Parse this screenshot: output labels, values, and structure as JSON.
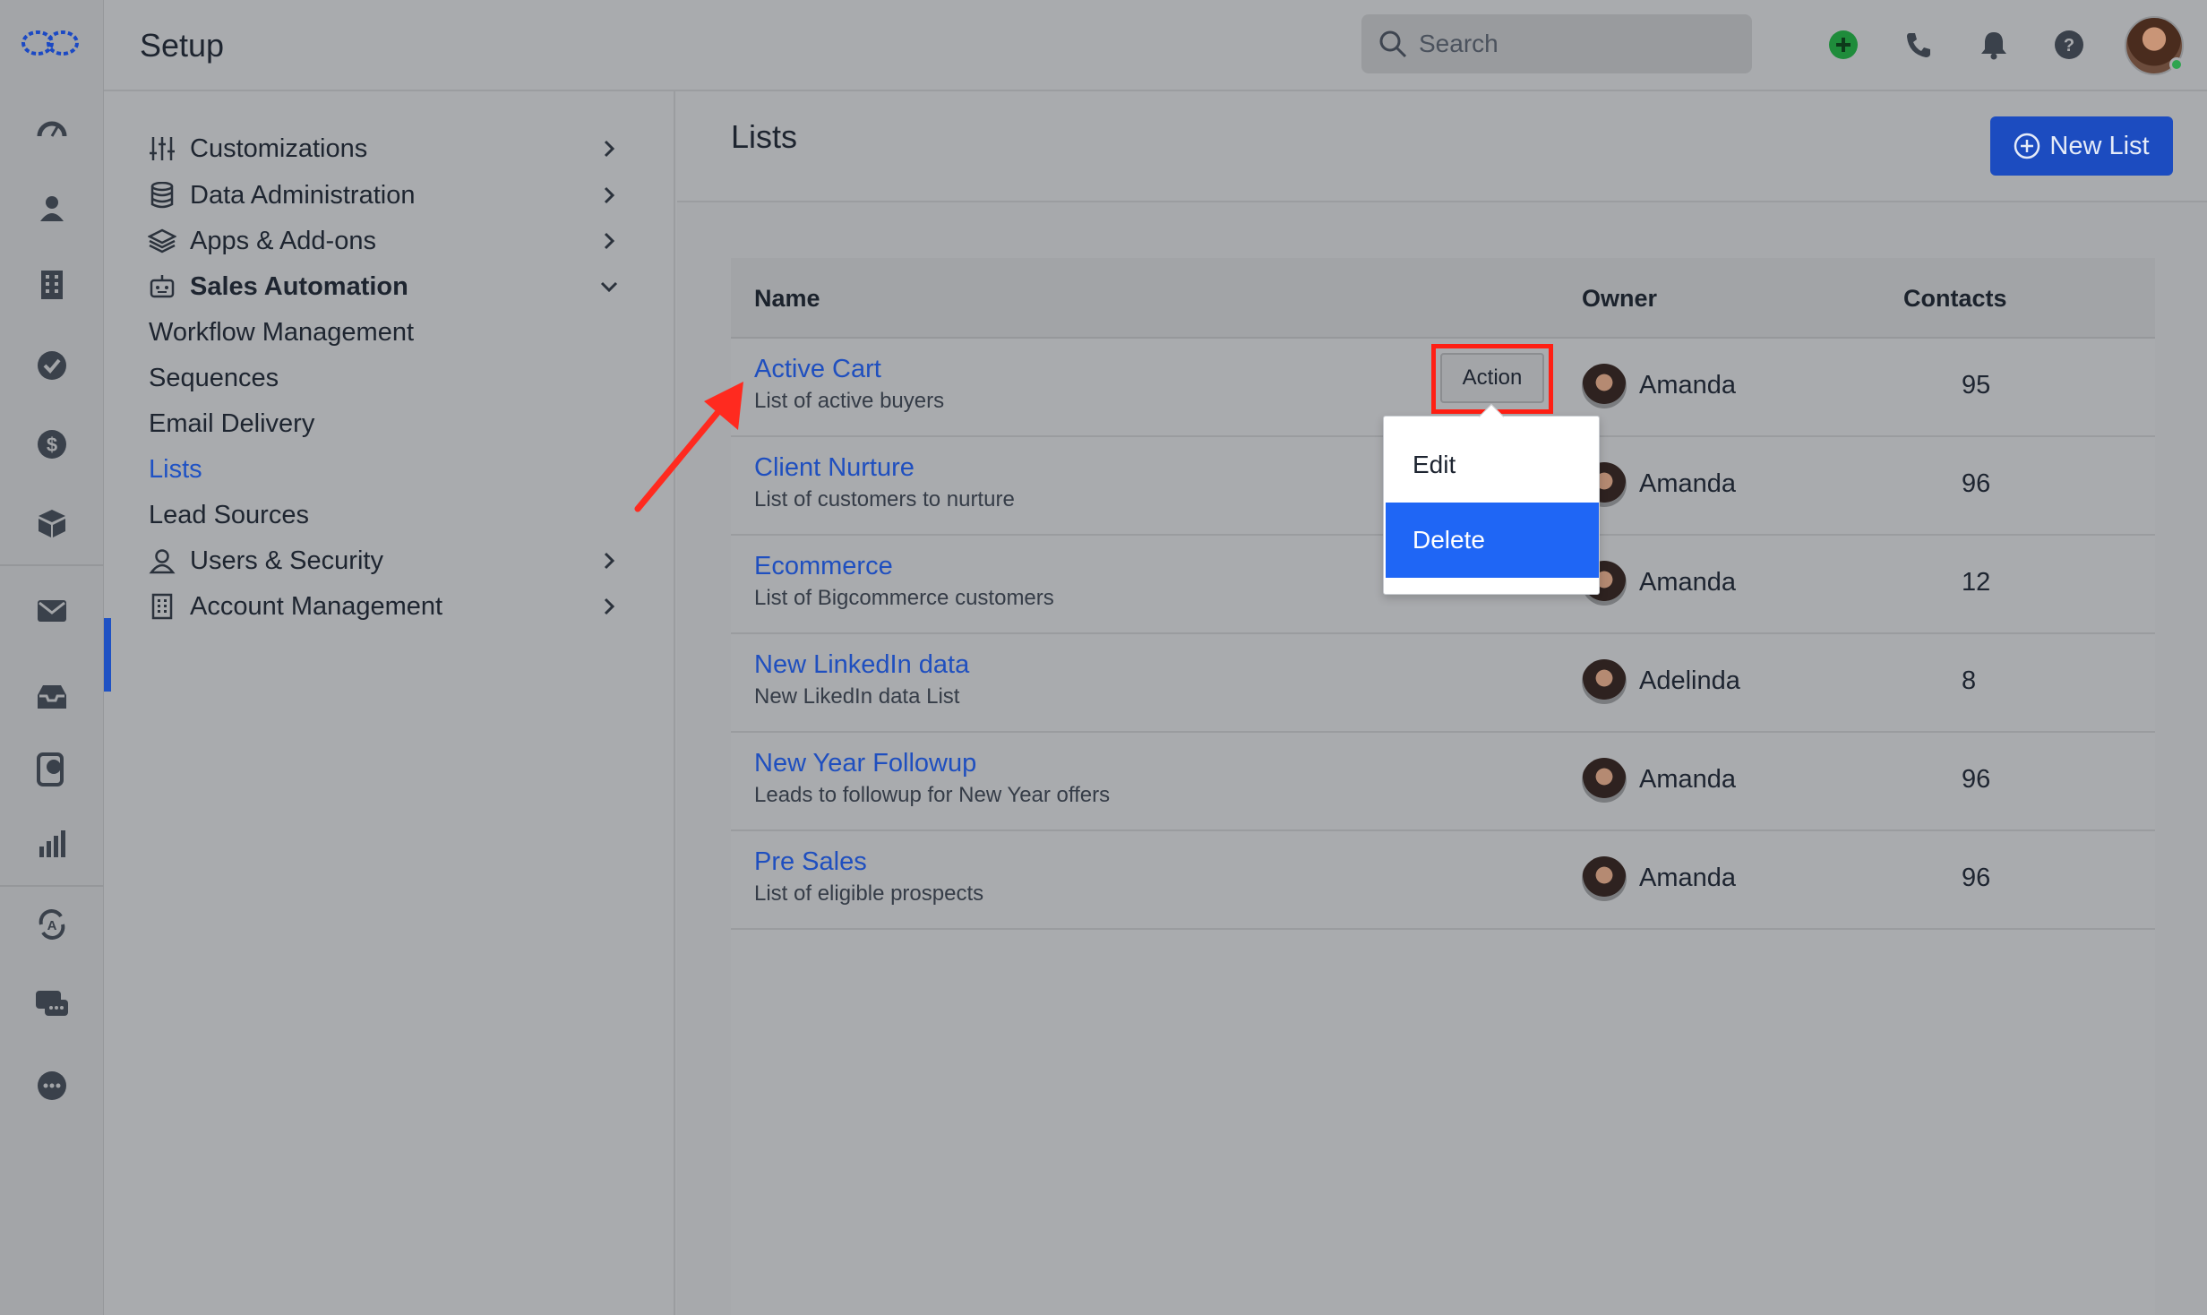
{
  "app": {
    "title": "Setup"
  },
  "search": {
    "placeholder": "Search"
  },
  "topbar": {
    "icons": [
      "add-circle-icon",
      "phone-icon",
      "bell-icon",
      "help-icon"
    ],
    "accent_add": "#2ea44f"
  },
  "rail": {
    "icons": [
      "logo-icon",
      "dashboard-icon",
      "contacts-icon",
      "accounts-icon",
      "tasks-icon",
      "deals-icon",
      "products-icon",
      "email-icon",
      "inbox-icon",
      "chat-support-icon",
      "reports-icon",
      "automation-icon",
      "messages-icon",
      "more-icon"
    ]
  },
  "nav": {
    "items": [
      {
        "label": "Customizations",
        "icon": "sliders-icon",
        "expandable": true
      },
      {
        "label": "Data Administration",
        "icon": "database-icon",
        "expandable": true
      },
      {
        "label": "Apps & Add-ons",
        "icon": "layers-icon",
        "expandable": true
      },
      {
        "label": "Sales Automation",
        "icon": "robot-icon",
        "expanded": true
      },
      {
        "label": "Workflow Management"
      },
      {
        "label": "Sequences"
      },
      {
        "label": "Email Delivery"
      },
      {
        "label": "Lists",
        "active": true
      },
      {
        "label": "Lead Sources"
      },
      {
        "label": "Users & Security",
        "icon": "user-icon",
        "expandable": true
      },
      {
        "label": "Account Management",
        "icon": "building-icon",
        "expandable": true
      }
    ]
  },
  "main": {
    "title": "Lists",
    "new_button": "New List",
    "columns": {
      "name": "Name",
      "owner": "Owner",
      "contacts": "Contacts"
    },
    "rows": [
      {
        "name": "Active Cart",
        "description": "List of active buyers",
        "owner": "Amanda",
        "contacts": "95"
      },
      {
        "name": "Client Nurture",
        "description": "List of customers to nurture",
        "owner": "Amanda",
        "contacts": "96"
      },
      {
        "name": "Ecommerce",
        "description": "List of Bigcommerce customers",
        "owner": "Amanda",
        "contacts": "12"
      },
      {
        "name": "New LinkedIn data",
        "description": "New LikedIn data List",
        "owner": "Adelinda",
        "contacts": "8"
      },
      {
        "name": "New Year Followup",
        "description": "Leads to followup for New Year offers",
        "owner": "Amanda",
        "contacts": "96"
      },
      {
        "name": "Pre Sales",
        "description": "List of eligible prospects",
        "owner": "Amanda",
        "contacts": "96"
      }
    ],
    "action_button": "Action",
    "action_menu": {
      "items": [
        "Edit",
        "Delete"
      ],
      "selected": "Delete"
    }
  },
  "colors": {
    "link": "#1f4fbf",
    "primary": "#1c4cc0",
    "selected": "#1f66f5",
    "highlight": "#ff1f14"
  }
}
